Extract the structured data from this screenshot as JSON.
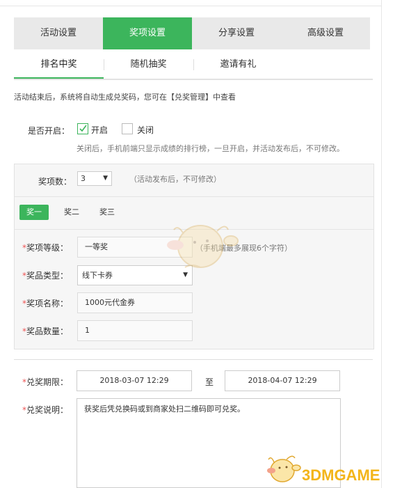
{
  "top_tabs": [
    "活动设置",
    "奖项设置",
    "分享设置",
    "高级设置"
  ],
  "sub_tabs": [
    "排名中奖",
    "随机抽奖",
    "邀请有礼"
  ],
  "notice": "活动结束后，系统将自动生成兑奖码，您可在【兑奖管理】中查看",
  "enable": {
    "label": "是否开启：",
    "on_label": "开启",
    "off_label": "关闭",
    "hint": "关闭后，手机前端只显示成绩的排行榜，一旦开启，并活动发布后，不可修改。"
  },
  "prize_count": {
    "label": "奖项数：",
    "value": "3",
    "hint": "（活动发布后，不可修改）"
  },
  "prize_tabs": [
    "奖一",
    "奖二",
    "奖三"
  ],
  "prize_form": {
    "level_label": "奖项等级：",
    "level_value": "一等奖",
    "level_hint": "（手机端最多展现6个字符）",
    "type_label": "奖品类型：",
    "type_value": "线下卡券",
    "name_label": "奖项名称：",
    "name_value": "1000元代金券",
    "qty_label": "奖品数量：",
    "qty_value": "1"
  },
  "redeem": {
    "period_label": "兑奖期限：",
    "start": "2018-03-07 12:29",
    "to": "至",
    "end": "2018-04-07 12:29",
    "desc_label": "兑奖说明：",
    "desc_value": "获奖后凭兑换码或到商家处扫二维码即可兑奖。"
  },
  "watermark": "3DMGAME",
  "colors": {
    "accent": "#3cb55c",
    "required_star": "#e55555",
    "watermark": "#f3b51a"
  }
}
